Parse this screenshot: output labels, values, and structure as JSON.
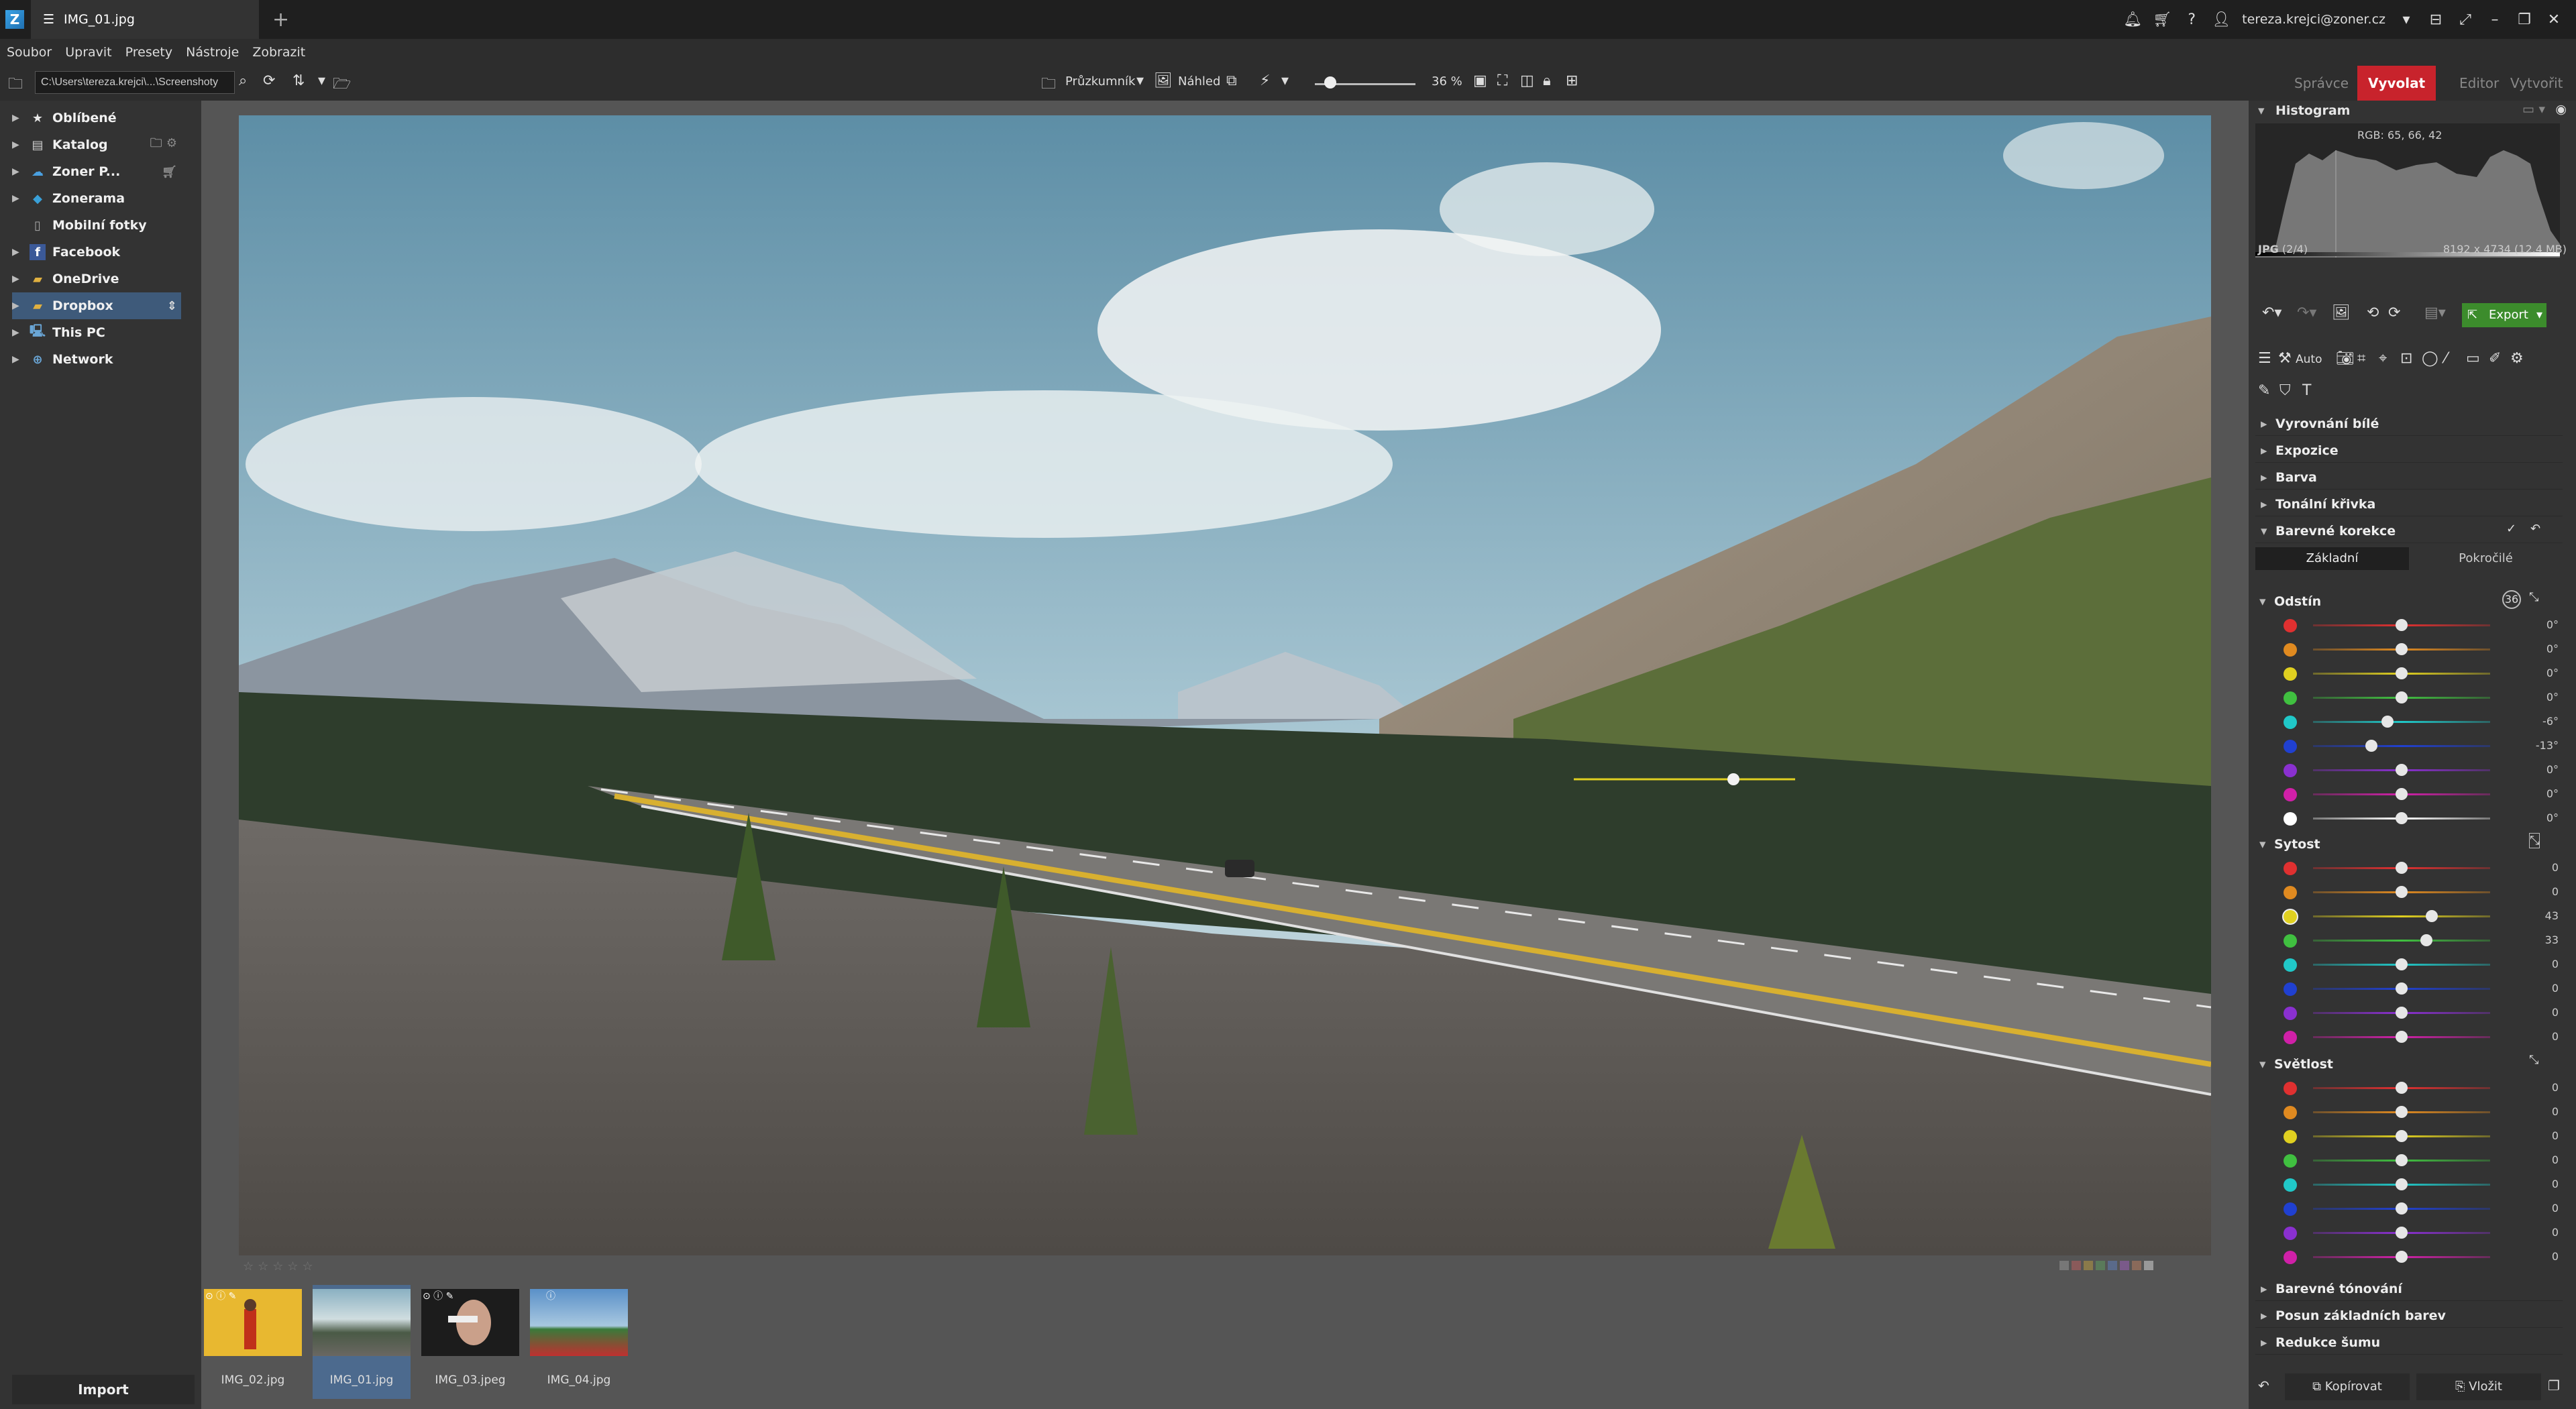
{
  "window": {
    "tab_title": "IMG_01.jpg",
    "user": "tereza.krejci@zoner.cz"
  },
  "menu": [
    "Soubor",
    "Upravit",
    "Presety",
    "Nástroje",
    "Zobrazit"
  ],
  "toolbar": {
    "path": "C:\\Users\\tereza.krejci\\...\\Screenshoty",
    "explorer_label": "Průzkumník",
    "preview_label": "Náhled",
    "zoom_value": "36 %"
  },
  "modes": [
    {
      "label": "Správce",
      "active": false
    },
    {
      "label": "Vyvolat",
      "active": true
    },
    {
      "label": "Editor",
      "active": false
    },
    {
      "label": "Vytvořit",
      "active": false
    }
  ],
  "navigator": [
    {
      "label": "Oblíbené",
      "icon": "star-icon",
      "color": "#e8e8e8"
    },
    {
      "label": "Katalog",
      "icon": "catalog-icon",
      "color": "#cfcfcf"
    },
    {
      "label": "Zoner P...",
      "icon": "cloud-icon",
      "color": "#4aa0e0"
    },
    {
      "label": "Zonerama",
      "icon": "zonerama-icon",
      "color": "#39a0d8"
    },
    {
      "label": "Mobilní fotky",
      "icon": "phone-icon",
      "color": "#aaaaaa"
    },
    {
      "label": "Facebook",
      "icon": "facebook-icon",
      "color": "#3b5998"
    },
    {
      "label": "OneDrive",
      "icon": "onedrive-icon",
      "color": "#e0b040"
    },
    {
      "label": "Dropbox",
      "icon": "dropbox-icon",
      "color": "#e0b040"
    },
    {
      "label": "This PC",
      "icon": "pc-icon",
      "color": "#6aa6d6"
    },
    {
      "label": "Network",
      "icon": "network-icon",
      "color": "#6aa6d6"
    }
  ],
  "import_label": "Import",
  "filmstrip": [
    {
      "label": "IMG_02.jpg",
      "selected": false
    },
    {
      "label": "IMG_01.jpg",
      "selected": true
    },
    {
      "label": "IMG_03.jpeg",
      "selected": false
    },
    {
      "label": "IMG_04.jpg",
      "selected": false
    }
  ],
  "histogram": {
    "title": "Histogram",
    "rgb": "RGB: 65, 66, 42",
    "format": "JPG",
    "index": "(2/4)",
    "dimensions": "8192 x 4734 (12.4 MB)"
  },
  "export_label": "Export",
  "auto_label": "Auto",
  "sections": {
    "white_balance": "Vyrovnání bílé",
    "exposure": "Expozice",
    "color": "Barva",
    "tone_curve": "Tonální křivka",
    "color_correction": "Barevné korekce",
    "color_toning": "Barevné tónování",
    "shift_primaries": "Posun základních barev",
    "noise_reduction": "Redukce šumu"
  },
  "subtabs": {
    "basic": "Základní",
    "advanced": "Pokročilé"
  },
  "groups": {
    "hue": {
      "title": "Odstín",
      "rows": [
        {
          "color": "#e03030",
          "value": "0°",
          "pos": 0.5
        },
        {
          "color": "#e08a20",
          "value": "0°",
          "pos": 0.5
        },
        {
          "color": "#e0d020",
          "value": "0°",
          "pos": 0.5
        },
        {
          "color": "#40c040",
          "value": "0°",
          "pos": 0.5
        },
        {
          "color": "#20c8c8",
          "value": "-6°",
          "pos": 0.42
        },
        {
          "color": "#2040d0",
          "value": "-13°",
          "pos": 0.33
        },
        {
          "color": "#8a30d0",
          "value": "0°",
          "pos": 0.5
        },
        {
          "color": "#d020a8",
          "value": "0°",
          "pos": 0.5
        },
        {
          "color": "#ffffff",
          "value": "0°",
          "pos": 0.5
        }
      ]
    },
    "saturation": {
      "title": "Sytost",
      "rows": [
        {
          "color": "#e03030",
          "value": "0",
          "pos": 0.5
        },
        {
          "color": "#e08a20",
          "value": "0",
          "pos": 0.5
        },
        {
          "color": "#e0d020",
          "value": "43",
          "pos": 0.67
        },
        {
          "color": "#40c040",
          "value": "33",
          "pos": 0.64
        },
        {
          "color": "#20c8c8",
          "value": "0",
          "pos": 0.5
        },
        {
          "color": "#2040d0",
          "value": "0",
          "pos": 0.5
        },
        {
          "color": "#8a30d0",
          "value": "0",
          "pos": 0.5
        },
        {
          "color": "#d020a8",
          "value": "0",
          "pos": 0.5
        }
      ]
    },
    "lightness": {
      "title": "Světlost",
      "rows": [
        {
          "color": "#e03030",
          "value": "0",
          "pos": 0.5
        },
        {
          "color": "#e08a20",
          "value": "0",
          "pos": 0.5
        },
        {
          "color": "#e0d020",
          "value": "0",
          "pos": 0.5
        },
        {
          "color": "#40c040",
          "value": "0",
          "pos": 0.5
        },
        {
          "color": "#20c8c8",
          "value": "0",
          "pos": 0.5
        },
        {
          "color": "#2040d0",
          "value": "0",
          "pos": 0.5
        },
        {
          "color": "#8a30d0",
          "value": "0",
          "pos": 0.5
        },
        {
          "color": "#d020a8",
          "value": "0",
          "pos": 0.5
        }
      ]
    }
  },
  "bottom": {
    "copy_label": "Kopírovat",
    "paste_label": "Vložit"
  },
  "colors": {
    "accent": "#c8232c",
    "export": "#3c8c2c",
    "selection": "#3e5a7a"
  }
}
